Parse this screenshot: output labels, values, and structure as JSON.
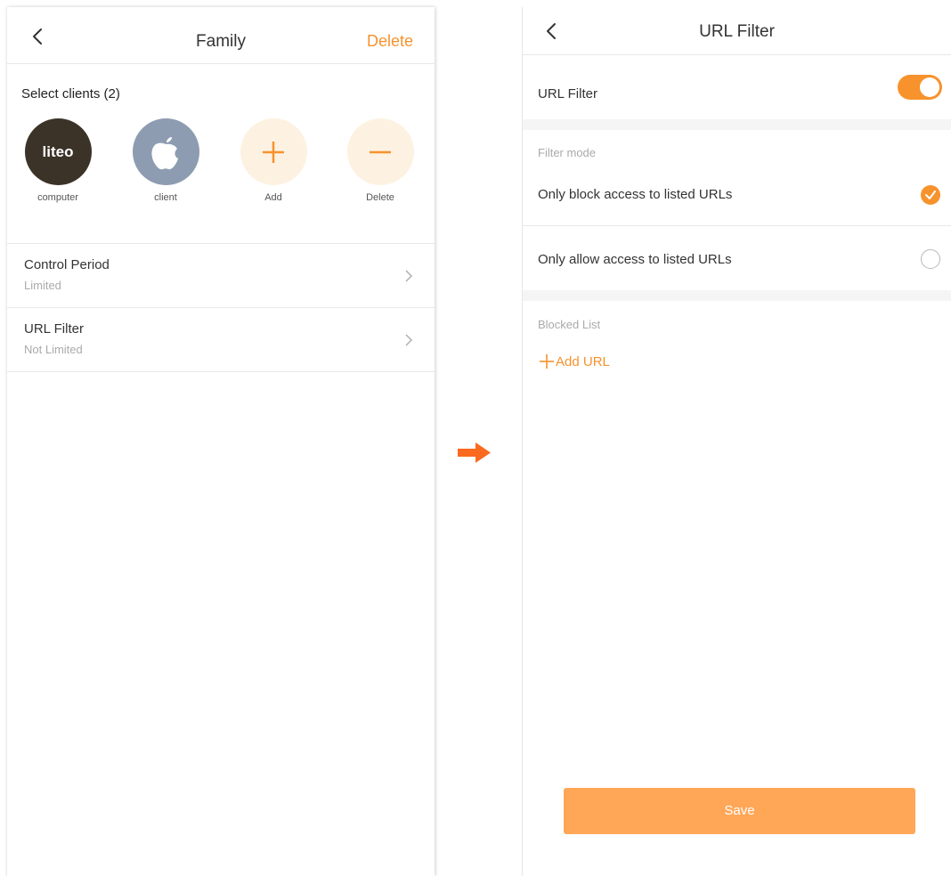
{
  "left_screen": {
    "nav": {
      "title": "Family",
      "action": "Delete"
    },
    "select_title": "Select clients (2)",
    "clients": [
      {
        "label": "computer",
        "avatar_text": "liteo",
        "icon": "liteo-logo"
      },
      {
        "label": "client",
        "icon": "apple-logo-icon"
      },
      {
        "label": "Add",
        "icon": "plus-icon"
      },
      {
        "label": "Delete",
        "icon": "minus-icon"
      }
    ],
    "rows": [
      {
        "title": "Control Period",
        "subtitle": "Limited"
      },
      {
        "title": "URL Filter",
        "subtitle": "Not Limited"
      }
    ]
  },
  "right_screen": {
    "nav": {
      "title": "URL Filter"
    },
    "url_filter": {
      "label": "URL Filter",
      "enabled": true
    },
    "filter_mode": {
      "section_label": "Filter mode",
      "options": [
        {
          "label": "Only block access to listed URLs",
          "selected": true
        },
        {
          "label": "Only allow access to listed URLs",
          "selected": false
        }
      ]
    },
    "blocked_list": {
      "section_label": "Blocked List",
      "add_label": "Add URL"
    },
    "save_label": "Save"
  },
  "colors": {
    "accent": "#f7922d",
    "save_button": "#ffa757",
    "arrow": "#fb6a1e",
    "avatar_dark": "#3b3328",
    "avatar_apple": "#8d9cb0",
    "soft_circle": "#fdf2e2"
  }
}
